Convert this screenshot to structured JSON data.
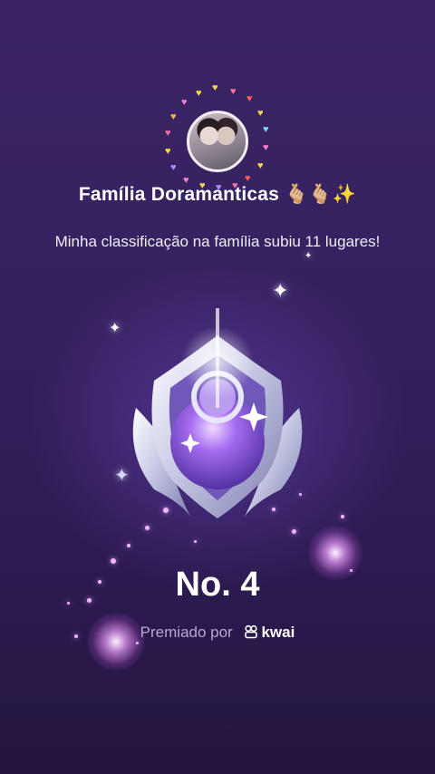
{
  "family": {
    "name": "Família Doramanticas 🫰🏼🫰🏼✨"
  },
  "message": "Minha classificação na família subiu 11 lugares!",
  "rank": {
    "label": "No. 4"
  },
  "awarded": {
    "prefix": "Premiado por",
    "brand": "kwai"
  },
  "icons": {
    "avatar": "avatar-photo",
    "badge": "rank-medal-icon",
    "brand": "kwai-logo-icon"
  },
  "colors": {
    "background": "#35215f",
    "text": "#ffffff",
    "muted": "#b7a9cf",
    "glow": "#e58bff"
  }
}
